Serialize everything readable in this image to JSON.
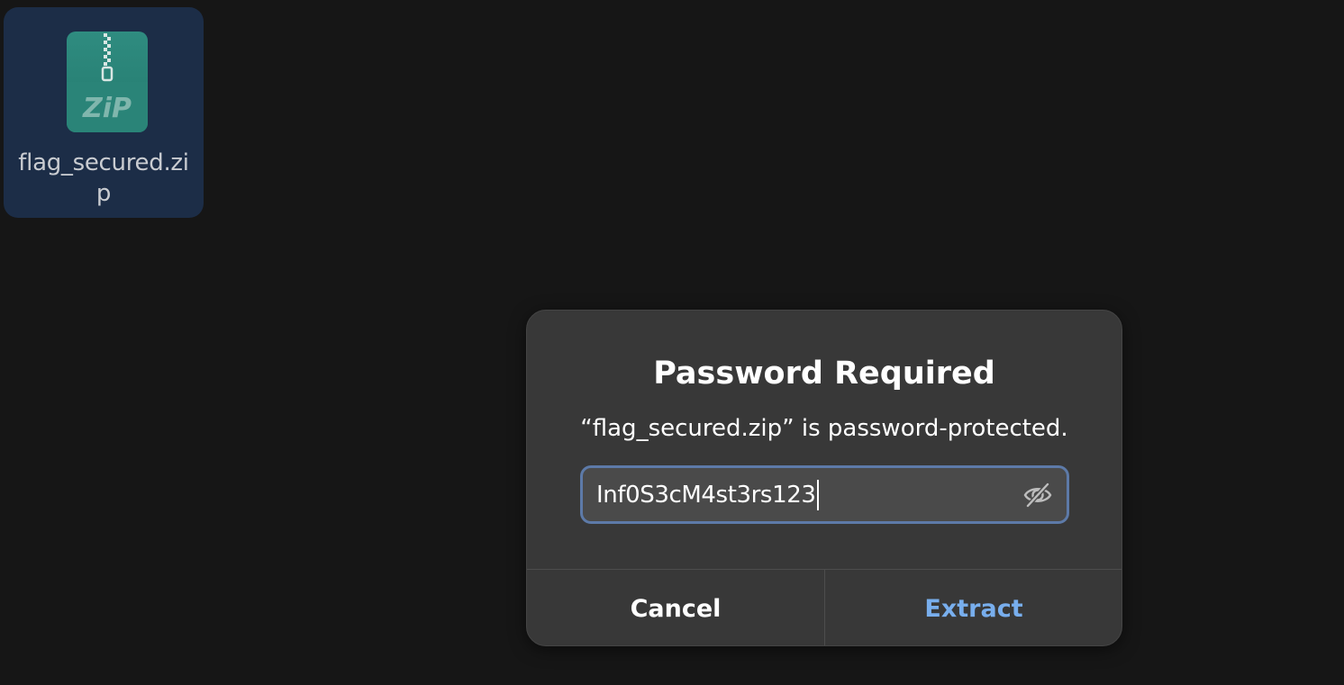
{
  "desktop": {
    "file": {
      "name": "flag_secured.zip",
      "icon": "zip-archive-icon",
      "icon_label": "ZiP"
    }
  },
  "dialog": {
    "title": "Password Required",
    "message": "“flag_secured.zip” is password-protected.",
    "password_value": "Inf0S3cM4st3rs123",
    "visibility_icon": "eye-slash-icon",
    "cancel_label": "Cancel",
    "extract_label": "Extract"
  },
  "colors": {
    "background": "#161616",
    "dialog_bg": "#383838",
    "accent": "#78aeed",
    "selection_bg": "#1c2d47",
    "zip_green": "#2e8b7e"
  }
}
